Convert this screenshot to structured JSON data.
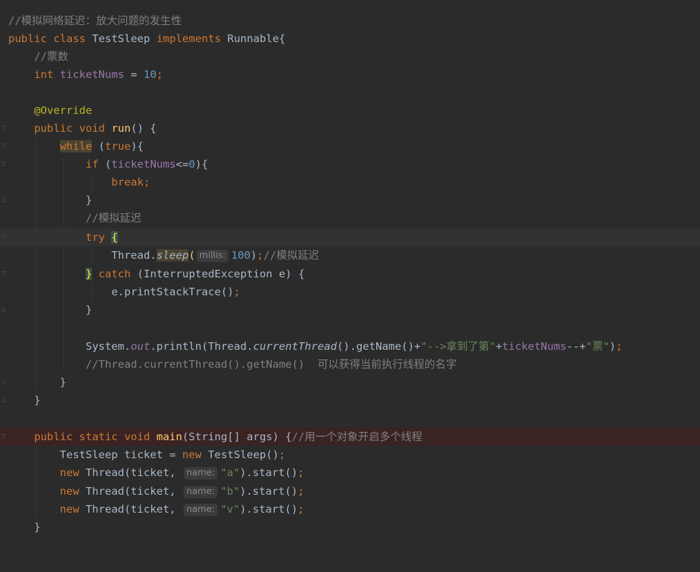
{
  "editor": {
    "class_name": "TestSleep",
    "lines": {
      "l1_comment": "//模拟网络延迟：放大问题的发生性",
      "l2_public": "public",
      "l2_class": "class",
      "l2_name": "TestSleep",
      "l2_implements": "implements",
      "l2_iface": "Runnable{",
      "l3_comment": "//票数",
      "l4_type": "int",
      "l4_field": "ticketNums",
      "l4_eq": " = ",
      "l4_val": "10",
      "l4_semi": ";",
      "l6_ann": "@Override",
      "l7_mods": "public void ",
      "l7_fn": "run",
      "l7_rest": "() {",
      "l8_while": "while",
      "l8_open": " (",
      "l8_true": "true",
      "l8_rest": "){",
      "l9_if": "if",
      "l9_open": " (",
      "l9_field": "ticketNums",
      "l9_op": "<=",
      "l9_num": "0",
      "l9_rest": "){",
      "l10_break": "break;",
      "l11_close": "}",
      "l12_comment": "//模拟延迟",
      "l13_try": "try",
      "l13_brace": "{",
      "l14_a": "Thread.",
      "l14_sleep": "sleep",
      "l14_paren": "(",
      "l14_hint": "millis:",
      "l14_num": "100",
      "l14_close": ")",
      "l14_semi": ";",
      "l14_comment": "//模拟延迟",
      "l15_brace": "}",
      "l15_catch": "catch",
      "l15_rest": " (InterruptedException e) {",
      "l16_a": "e.printStackTrace()",
      "l16_semi": ";",
      "l17_close": "}",
      "l19_a": "System.",
      "l19_out": "out",
      "l19_b": ".println(Thread.",
      "l19_ct": "currentThread",
      "l19_c": "().getName()+",
      "l19_s1": "\"-->拿到了第\"",
      "l19_plus": "+",
      "l19_field": "ticketNums",
      "l19_d": "--+",
      "l19_s2": "\"票\"",
      "l19_e": ")",
      "l19_semi": ";",
      "l20_comment": "//Thread.currentThread().getName()  可以获得当前执行线程的名字",
      "l21_close": "}",
      "l22_close": "}",
      "l24_mods": "public static void ",
      "l24_fn": "main",
      "l24_rest": "(String[] args) {",
      "l24_comment": "//用一个对象开启多个线程",
      "l25_a": "TestSleep ticket = ",
      "l25_new": "new",
      "l25_b": " TestSleep()",
      "l25_semi": ";",
      "new_kw": "new",
      "thread_ticket": " Thread(ticket, ",
      "name_hint": "name:",
      "l26_str": "\"a\"",
      "l27_str": "\"b\"",
      "l28_str": "\"v\"",
      "start_call": ").start()",
      "semi": ";",
      "l29_close": "}"
    }
  },
  "colors": {
    "background": "#2b2b2b",
    "keyword": "#cc7832",
    "number": "#6897bb",
    "comment": "#808080",
    "string": "#6a8759",
    "method": "#ffc66d",
    "field": "#9876aa",
    "annotation": "#bbb529"
  }
}
